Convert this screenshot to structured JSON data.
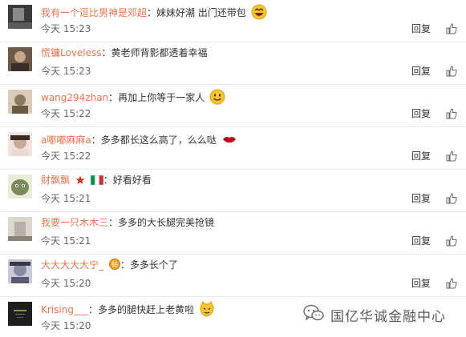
{
  "comments": [
    {
      "user": "我有一个逗比男神是邓超",
      "text": "妹妹好潮 出门还带包",
      "time": "今天 15:23",
      "emoji": "laughing-face",
      "avatar_color": "#3a3a3a"
    },
    {
      "user": "慌镛Loveless",
      "text": "黄老师背影都透着幸福",
      "time": "今天 15:23",
      "emoji": "",
      "avatar_color": "#6b5a4a"
    },
    {
      "user": "wang294zhan",
      "text": "再加上你等于一家人",
      "time": "今天 15:22",
      "emoji": "smile-face",
      "avatar_color": "#8a7a60"
    },
    {
      "user": "a嘟嘟麻麻a",
      "text": "多多都长这么高了，么么哒",
      "time": "今天 15:22",
      "emoji": "lips",
      "avatar_color": "#c9a89a"
    },
    {
      "user": "财飘飘",
      "text": "好看好看",
      "time": "今天 15:21",
      "emoji": "",
      "avatar_color": "#7a8a5a"
    },
    {
      "user": "我要一只木木三",
      "text": "多多的大长腿完美抢镜",
      "time": "今天 15:21",
      "emoji": "",
      "avatar_color": "#b8b0a8"
    },
    {
      "user": "大大大大大宁_",
      "text": "多多长个了",
      "time": "今天 15:20",
      "emoji": "",
      "avatar_color": "#8a8aa0",
      "badge": "钻"
    },
    {
      "user": "Krising___",
      "text": "多多的腿快赶上老黄啦",
      "time": "今天 15:20",
      "emoji": "cat-face",
      "avatar_color": "#1e1e1e"
    }
  ],
  "actions": {
    "reply_label": "回复"
  },
  "watermark": {
    "text": "国亿华诚金融中心"
  },
  "colors": {
    "username": "#eb7350",
    "divider": "#e8e8e8",
    "text": "#333333",
    "time": "#666666"
  }
}
